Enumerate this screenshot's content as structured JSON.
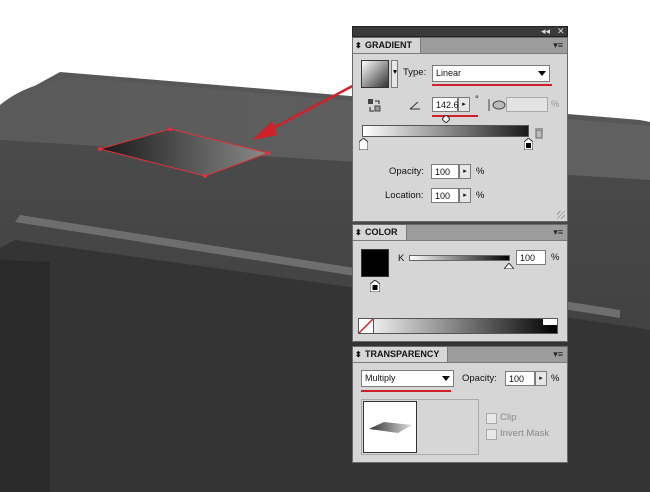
{
  "window": {
    "collapse_glyph": "◂◂",
    "close_glyph": "✕"
  },
  "gradient_panel": {
    "title": "GRADIENT",
    "type_label": "Type:",
    "type_value": "Linear",
    "angle_value": "142.6",
    "angle_unit": "°",
    "aspect_unit": "%",
    "opacity_label": "Opacity:",
    "opacity_value": "100",
    "location_label": "Location:",
    "location_value": "100",
    "percent": "%"
  },
  "color_panel": {
    "title": "COLOR",
    "channel_label": "K",
    "k_value": "100",
    "percent": "%"
  },
  "transparency_panel": {
    "title": "TRANSPARENCY",
    "blend_mode": "Multiply",
    "opacity_label": "Opacity:",
    "opacity_value": "100",
    "percent": "%",
    "clip_label": "Clip",
    "invert_mask_label": "Invert Mask"
  },
  "icons": {
    "panel_menu": "▾≡",
    "stepper_right": "▸",
    "tab_arrow": "⬍"
  },
  "colors": {
    "accent_red": "#d0212b",
    "panel_bg": "#d6d6d6",
    "tab_bar": "#9c9c9c"
  }
}
